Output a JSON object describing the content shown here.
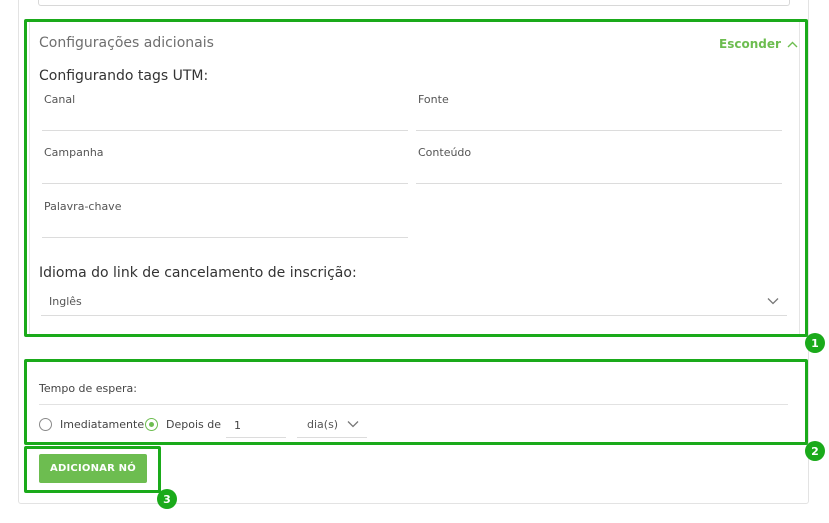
{
  "additional_settings": {
    "title": "Configurações adicionais",
    "toggle_label": "Esconder",
    "toggle_icon": "chevron-up-icon",
    "utm": {
      "heading": "Configurando tags UTM:",
      "fields": {
        "channel": {
          "label": "Canal",
          "value": ""
        },
        "source": {
          "label": "Fonte",
          "value": ""
        },
        "campaign": {
          "label": "Campanha",
          "value": ""
        },
        "content": {
          "label": "Conteúdo",
          "value": ""
        },
        "keyword": {
          "label": "Palavra-chave",
          "value": ""
        }
      }
    },
    "unsubscribe_language": {
      "heading": "Idioma do link de cancelamento de inscrição:",
      "selected": "Inglês"
    }
  },
  "wait_time": {
    "label": "Tempo de espera:",
    "options": {
      "immediately": {
        "label": "Imediatamente",
        "selected": false
      },
      "after": {
        "label": "Depois de",
        "selected": true
      }
    },
    "amount": "1",
    "unit": "dia(s)"
  },
  "add_node_button": "ADICIONAR NÓ",
  "annotations": [
    "1",
    "2",
    "3"
  ],
  "colors": {
    "accent": "#6dbd50",
    "highlight": "#1aaa1a"
  }
}
